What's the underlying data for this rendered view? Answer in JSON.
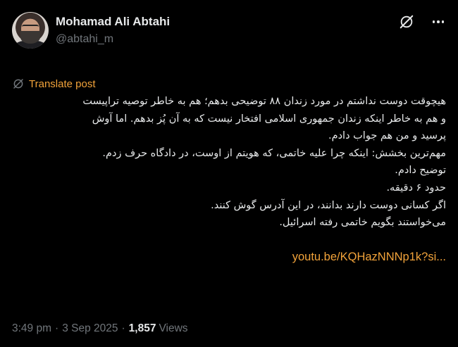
{
  "author": {
    "display_name": "Mohamad Ali Abtahi",
    "handle": "@abtahi_m"
  },
  "icons": {
    "avatar": "avatar-photo",
    "grok": "grok-icon",
    "more": "more-icon",
    "translate": "translate-icon"
  },
  "translate_label": "Translate post",
  "post_lines": [
    "هیچوقت دوست نداشتم در مورد زندان ۸۸ توضیحی بدهم؛ هم به خاطر توصیه تراپیست",
    "و هم به خاطر اینکه زندان جمهوری اسلامی افتخار نیست که به آن پُز بدهم. اما آوش",
    "پرسید و من هم جواب دادم.",
    "مهم‌ترین بخشش: اینکه چرا علیه خاتمی، که هویتم از اوست، در دادگاه حرف زدم.",
    "توضیح دادم.",
    "حدود ۶ دقیقه.",
    "اگر کسانی دوست دارند بدانند، در این آدرس گوش کنند.",
    "می‌خواستند بگویم خاتمی رفته اسرائیل."
  ],
  "link_text": "youtu.be/KQHazNNNp1k?si...",
  "meta": {
    "time": "3:49 pm",
    "separator": "·",
    "date": "3 Sep 2025",
    "views_count": "1,857",
    "views_label": "Views"
  },
  "colors": {
    "background": "#000000",
    "text": "#e7e9ea",
    "muted": "#71767b",
    "accent": "#f2a33a"
  }
}
